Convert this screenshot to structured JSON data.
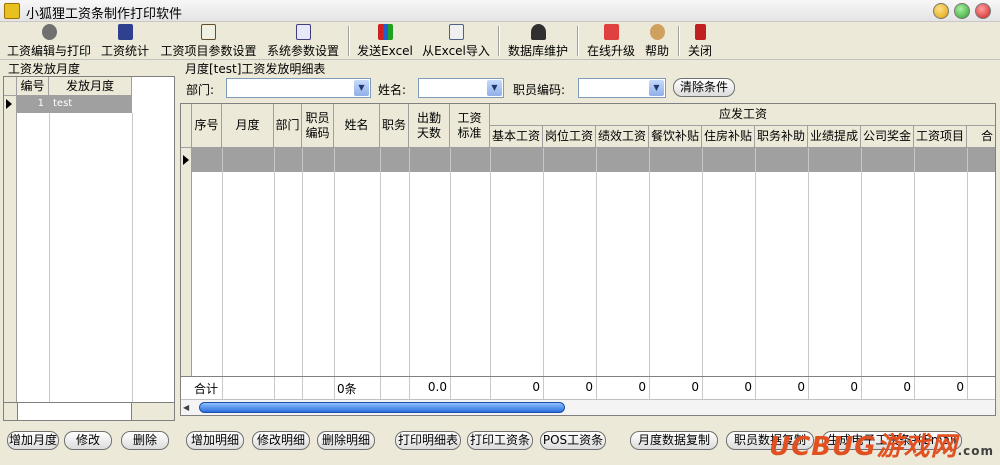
{
  "window": {
    "title": "小狐狸工资条制作打印软件"
  },
  "toolbar": {
    "items": [
      {
        "label": "工资编辑与打印",
        "icon": "gear-icon"
      },
      {
        "label": "工资统计",
        "icon": "stats-icon"
      },
      {
        "label": "工资项目参数设置",
        "icon": "document-icon"
      },
      {
        "label": "系统参数设置",
        "icon": "calendar-icon"
      },
      {
        "label": "发送Excel",
        "icon": "chart-icon"
      },
      {
        "label": "从Excel导入",
        "icon": "import-icon"
      },
      {
        "label": "数据库维护",
        "icon": "person-icon"
      },
      {
        "label": "在线升级",
        "icon": "upgrade-icon"
      },
      {
        "label": "帮助",
        "icon": "help-icon"
      },
      {
        "label": "关闭",
        "icon": "exit-icon"
      }
    ]
  },
  "left_panel": {
    "title": "工资发放月度",
    "columns": [
      "编号",
      "发放月度"
    ],
    "rows": [
      {
        "id": "1",
        "month": "test"
      }
    ],
    "buttons": {
      "add": "增加月度",
      "edit": "修改",
      "delete": "删除"
    }
  },
  "right_panel": {
    "title": "月度[test]工资发放明细表",
    "filters": {
      "department_label": "部门:",
      "name_label": "姓名:",
      "employee_code_label": "职员编码:",
      "clear_button": "清除条件",
      "department_value": "",
      "name_value": "",
      "employee_code_value": ""
    },
    "columns": [
      "序号",
      "月度",
      "部门",
      "职员编码",
      "姓名",
      "职务",
      "出勤天数",
      "工资标准"
    ],
    "group_header": "应发工资",
    "pay_columns": [
      "基本工资",
      "岗位工资",
      "绩效工资",
      "餐饮补贴",
      "住房补贴",
      "职务补助",
      "业绩提成",
      "公司奖金",
      "工资项目",
      "合"
    ],
    "summary": {
      "label": "合计",
      "count": "0条",
      "attendance": "0.0",
      "pay_values": [
        "0",
        "0",
        "0",
        "0",
        "0",
        "0",
        "0",
        "0",
        "0"
      ]
    },
    "buttons": {
      "add_detail": "增加明细",
      "edit_detail": "修改明细",
      "delete_detail": "删除明细",
      "print_detail": "打印明细表",
      "print_slip": "打印工资条",
      "pos_slip": "POS工资条",
      "copy_month": "月度数据复制",
      "copy_employee": "职员数据复制",
      "email_slip": "生成电子工资条并Email"
    }
  },
  "watermark": {
    "text": "UCBUG游戏网",
    "subtext": ".com"
  }
}
